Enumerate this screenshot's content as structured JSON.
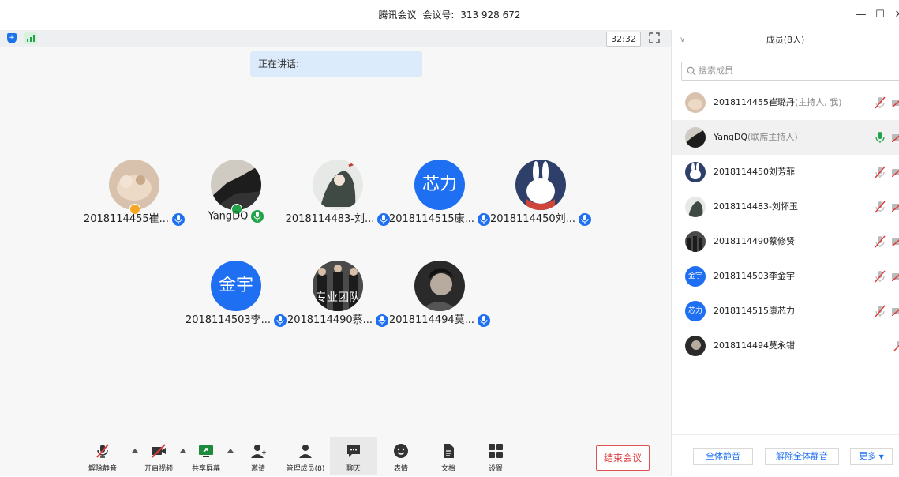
{
  "window": {
    "app_name": "腾讯会议",
    "meeting_id_label": "会议号:",
    "meeting_id": "313 928 672",
    "minimize": "—",
    "maximize": "☐",
    "close": "✕"
  },
  "status": {
    "timer": "32:32",
    "speaking_label": "正在讲话:"
  },
  "tiles": [
    {
      "name": "2018114455崔...",
      "avatar_text": "",
      "role": "host",
      "mic": "on"
    },
    {
      "name": "YangDQ",
      "avatar_text": "",
      "role": "cohost",
      "mic": "speaking"
    },
    {
      "name": "2018114483-刘...",
      "avatar_text": "",
      "role": "",
      "mic": "on"
    },
    {
      "name": "2018114515康...",
      "avatar_text": "芯力",
      "role": "",
      "mic": "on"
    },
    {
      "name": "2018114450刘...",
      "avatar_text": "",
      "role": "",
      "mic": "on"
    },
    {
      "name": "2018114503李...",
      "avatar_text": "金宇",
      "role": "",
      "mic": "on"
    },
    {
      "name": "2018114490蔡...",
      "avatar_text": "专业团队",
      "role": "",
      "mic": "on"
    },
    {
      "name": "2018114494莫...",
      "avatar_text": "",
      "role": "",
      "mic": "on"
    }
  ],
  "toolbar": {
    "unmute": "解除静音",
    "start_video": "开启视频",
    "share_screen": "共享屏幕",
    "invite": "邀请",
    "manage_members": "管理成员(8)",
    "chat": "聊天",
    "reactions": "表情",
    "documents": "文档",
    "settings": "设置",
    "end_meeting": "结束会议"
  },
  "panel": {
    "title": "成员(8人)",
    "search_placeholder": "搜索成员",
    "members": [
      {
        "name": "2018114455崔璐丹",
        "role": "(主持人, 我)",
        "avatar_text": ""
      },
      {
        "name": "YangDQ",
        "role": "(联席主持人)",
        "avatar_text": ""
      },
      {
        "name": "2018114450刘芳菲",
        "role": "",
        "avatar_text": ""
      },
      {
        "name": "2018114483-刘怀玉",
        "role": "",
        "avatar_text": ""
      },
      {
        "name": "2018114490蔡修贤",
        "role": "",
        "avatar_text": ""
      },
      {
        "name": "2018114503李金宇",
        "role": "",
        "avatar_text": "金宇"
      },
      {
        "name": "2018114515康芯力",
        "role": "",
        "avatar_text": "芯力"
      },
      {
        "name": "2018114494莫永钳",
        "role": "",
        "avatar_text": ""
      }
    ],
    "mute_all": "全体静音",
    "unmute_all": "解除全体静音",
    "more": "更多"
  },
  "colors": {
    "accent": "#1e6ff2",
    "end_red": "#e03c3c",
    "speaking_green": "#21a34a"
  }
}
